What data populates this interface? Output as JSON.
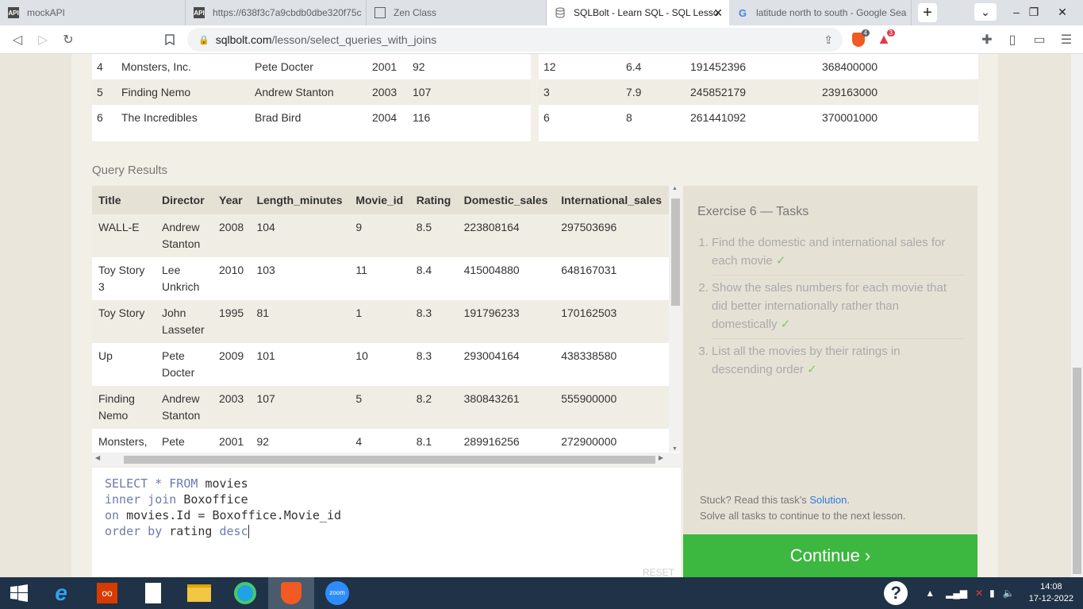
{
  "browser": {
    "tabs": [
      {
        "title": "mockAPI",
        "icon": "mockapi-icon"
      },
      {
        "title": "https://638f3c7a9cbdb0dbe320f75c",
        "icon": "mockapi-icon"
      },
      {
        "title": "Zen Class",
        "icon": "zen-class-icon"
      },
      {
        "title": "SQLBolt - Learn SQL - SQL Lesso",
        "icon": "database-icon",
        "active": true
      },
      {
        "title": "latitude north to south - Google Sea",
        "icon": "google-icon"
      }
    ],
    "url_host": "sqlbolt.com",
    "url_path": "/lesson/select_queries_with_joins",
    "brave_badge": "4",
    "rewards_badge": "3"
  },
  "top_table_left": {
    "rows": [
      [
        "4",
        "Monsters, Inc.",
        "Pete Docter",
        "2001",
        "92"
      ],
      [
        "5",
        "Finding Nemo",
        "Andrew Stanton",
        "2003",
        "107"
      ],
      [
        "6",
        "The Incredibles",
        "Brad Bird",
        "2004",
        "116"
      ]
    ]
  },
  "top_table_right": {
    "rows": [
      [
        "12",
        "6.4",
        "191452396",
        "368400000"
      ],
      [
        "3",
        "7.9",
        "245852179",
        "239163000"
      ],
      [
        "6",
        "8",
        "261441092",
        "370001000"
      ]
    ]
  },
  "query_results": {
    "label": "Query Results",
    "columns": [
      "Title",
      "Director",
      "Year",
      "Length_minutes",
      "Movie_id",
      "Rating",
      "Domestic_sales",
      "International_sales"
    ],
    "rows": [
      [
        "WALL-E",
        "Andrew Stanton",
        "2008",
        "104",
        "9",
        "8.5",
        "223808164",
        "297503696"
      ],
      [
        "Toy Story 3",
        "Lee Unkrich",
        "2010",
        "103",
        "11",
        "8.4",
        "415004880",
        "648167031"
      ],
      [
        "Toy Story",
        "John Lasseter",
        "1995",
        "81",
        "1",
        "8.3",
        "191796233",
        "170162503"
      ],
      [
        "Up",
        "Pete Docter",
        "2009",
        "101",
        "10",
        "8.3",
        "293004164",
        "438338580"
      ],
      [
        "Finding Nemo",
        "Andrew Stanton",
        "2003",
        "107",
        "5",
        "8.2",
        "380843261",
        "555900000"
      ],
      [
        "Monsters, Inc.",
        "Pete Docter",
        "2001",
        "92",
        "4",
        "8.1",
        "289916256",
        "272900000"
      ]
    ]
  },
  "editor": {
    "lines": [
      [
        {
          "t": "SELECT * FROM ",
          "k": true
        },
        {
          "t": "movies",
          "k": false
        }
      ],
      [
        {
          "t": "inner join ",
          "k": true
        },
        {
          "t": "Boxoffice",
          "k": false
        }
      ],
      [
        {
          "t": "on ",
          "k": true
        },
        {
          "t": "movies.Id = Boxoffice.Movie_id",
          "k": false
        }
      ],
      [
        {
          "t": "order by ",
          "k": true
        },
        {
          "t": "rating ",
          "k": false
        },
        {
          "t": "desc",
          "k": true
        }
      ]
    ],
    "reset_label": "RESET"
  },
  "tasks": {
    "title": "Exercise 6 — Tasks",
    "items": [
      {
        "text": "Find the domestic and international sales for each movie",
        "done": "✓"
      },
      {
        "text": "Show the sales numbers for each movie that did better internationally rather than domestically",
        "done": "✓"
      },
      {
        "text": "List all the movies by their ratings in descending order",
        "done": "✓"
      }
    ],
    "help_prefix": "Stuck? Read this task's ",
    "help_link": "Solution",
    "help_suffix": ".",
    "help_line2": "Solve all tasks to continue to the next lesson.",
    "continue_label": "Continue ›"
  },
  "taskbar": {
    "time": "14:08",
    "date": "17-12-2022"
  }
}
